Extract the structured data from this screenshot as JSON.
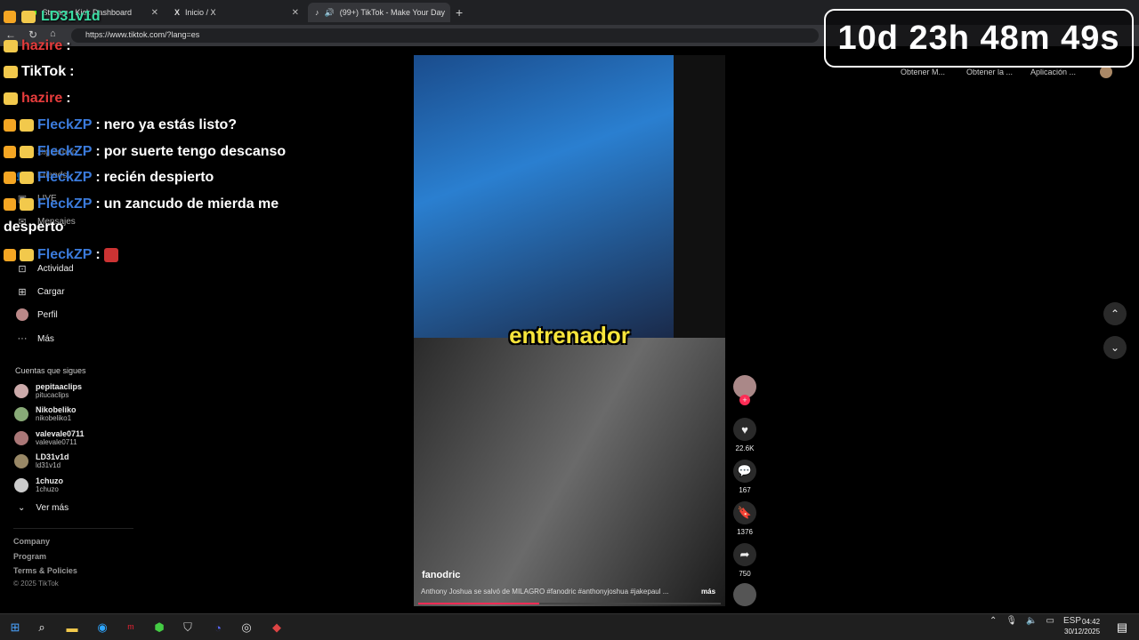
{
  "browser": {
    "tabs": [
      {
        "title": "Stream - Kick Dashboard",
        "active": false
      },
      {
        "title": "Inicio / X",
        "active": false
      },
      {
        "title": "(99+) TikTok - Make Your Day",
        "active": true
      }
    ],
    "url": "https://www.tiktok.com/?lang=es"
  },
  "extensions": [
    "Obtener M...",
    "Obtener la ...",
    "Aplicación ..."
  ],
  "sidebar": {
    "nav": [
      {
        "label": "Siguiendo",
        "icon": "following-icon"
      },
      {
        "label": "Friends",
        "icon": "friends-icon"
      },
      {
        "label": "LIVE",
        "icon": "live-icon"
      },
      {
        "label": "Mensajes",
        "icon": "messages-icon"
      },
      {
        "label": "Actividad",
        "icon": "activity-icon"
      },
      {
        "label": "Cargar",
        "icon": "upload-icon"
      },
      {
        "label": "Perfil",
        "icon": "profile-icon"
      },
      {
        "label": "Más",
        "icon": "more-icon"
      }
    ],
    "following_title": "Cuentas que sigues",
    "following": [
      {
        "name": "pepitaaclips",
        "handle": "pitucaclips"
      },
      {
        "name": "Nikobeliko",
        "handle": "nikobeliko1"
      },
      {
        "name": "valevale0711",
        "handle": "valevale0711"
      },
      {
        "name": "LD31v1d",
        "handle": "ld31v1d"
      },
      {
        "name": "1chuzo",
        "handle": "1chuzo"
      }
    ],
    "see_more": "Ver más",
    "footer": [
      "Company",
      "Program",
      "Terms & Policies"
    ],
    "copyright": "© 2025 TikTok"
  },
  "chat_overlay": {
    "stream_name": "LD31v1d",
    "lines": [
      {
        "user": "hazire",
        "color": "red",
        "message": ""
      },
      {
        "user": "TikTok",
        "color": "plain",
        "message": ""
      },
      {
        "user": "hazire",
        "color": "red",
        "message": ""
      },
      {
        "user": "FleckZP",
        "color": "blue",
        "message": "nero ya estás listo?"
      },
      {
        "user": "FleckZP",
        "color": "blue",
        "message": "por suerte tengo descanso"
      },
      {
        "user": "FleckZP",
        "color": "blue",
        "message": "recién despierto"
      },
      {
        "user": "FleckZP",
        "color": "blue",
        "message": "un zancudo de mierda me"
      },
      {
        "user": "",
        "color": "plain",
        "message": "desperto"
      },
      {
        "user": "FleckZP",
        "color": "blue",
        "message": ""
      }
    ]
  },
  "timer": "10d 23h 48m 49s",
  "video": {
    "caption_word": "entrenador",
    "author": "fanodric",
    "description": "Anthony Joshua se salvó de MILAGRO #fanodric #anthonyjoshua #jakepaul ...",
    "more": "más",
    "likes": "22.6K",
    "comments": "167",
    "saves": "1376",
    "shares": "750"
  },
  "taskbar": {
    "lang": "ESP",
    "time": "04:42",
    "date": "30/12/2025"
  }
}
